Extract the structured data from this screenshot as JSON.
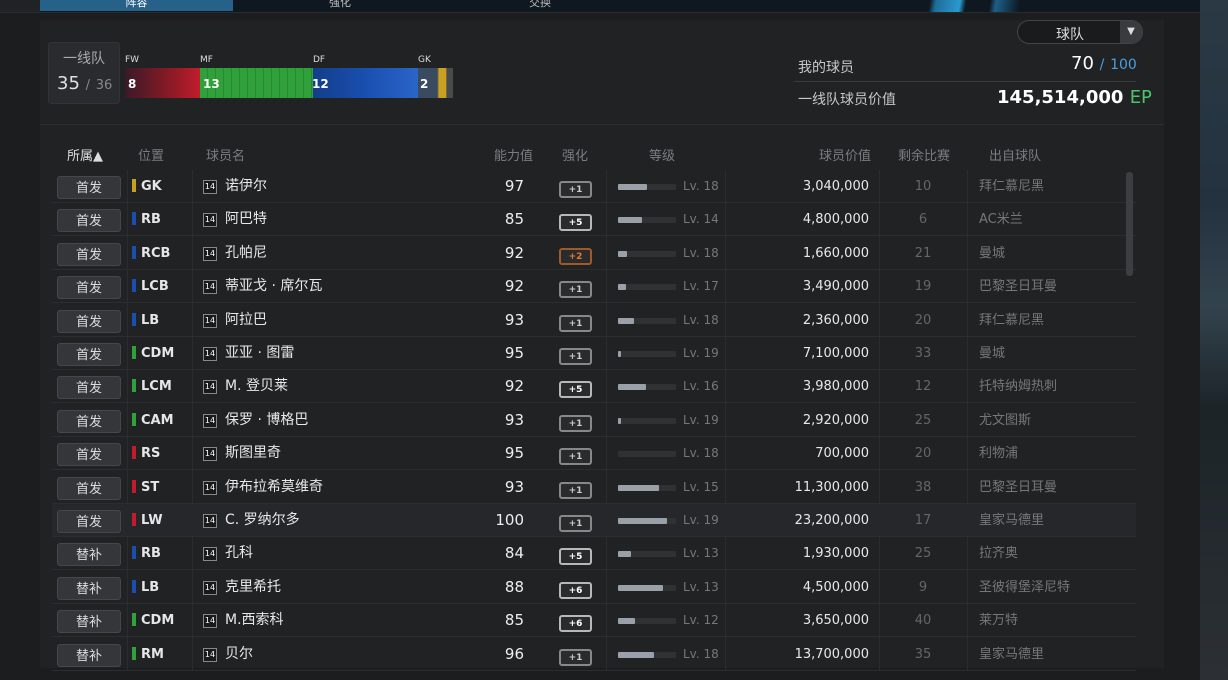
{
  "colors": {
    "fw": "#c01c2c",
    "mf": "#2fa03a",
    "df": "#1a4fb0",
    "gk": "#c9a020",
    "accent": "#4a9ee0",
    "ep": "#4cc46a"
  },
  "top_tabs": [
    "阵容",
    "强化",
    "交换"
  ],
  "summary": {
    "label": "一线队",
    "count": "35",
    "sep": "/",
    "max": "36"
  },
  "pos_labels": {
    "fw": "FW",
    "mf": "MF",
    "df": "DF",
    "gk": "GK"
  },
  "pos_counts": {
    "fw": "8",
    "mf": "13",
    "df": "12",
    "gk": "2"
  },
  "dropdown": {
    "value": "球队",
    "arrow": "▼"
  },
  "my_players": {
    "label": "我的球员",
    "value": "70",
    "sep": "/",
    "max": "100"
  },
  "first_team_value": {
    "label": "一线队球员价值",
    "value": "145,514,000",
    "unit": "EP"
  },
  "headers": {
    "category": "所属▲",
    "position": "位置",
    "name": "球员名",
    "ovr": "能力值",
    "enh": "强化",
    "level": "等级",
    "value": "球员价值",
    "games": "剩余比赛",
    "club": "出自球队"
  },
  "season_badge": "14",
  "rows": [
    {
      "cat": "首发",
      "pos": "GK",
      "pc": "gk",
      "name": "诺伊尔",
      "ovr": "97",
      "enh": "+1",
      "et": "n",
      "lvl": "Lv. 18",
      "lp": 0.5,
      "val": "3,040,000",
      "rem": "10",
      "club": "拜仁慕尼黑"
    },
    {
      "cat": "首发",
      "pos": "RB",
      "pc": "df",
      "name": "阿巴特",
      "ovr": "85",
      "enh": "+5",
      "et": "hi",
      "lvl": "Lv. 14",
      "lp": 0.42,
      "val": "4,800,000",
      "rem": "6",
      "club": "AC米兰"
    },
    {
      "cat": "首发",
      "pos": "RCB",
      "pc": "df",
      "name": "孔帕尼",
      "ovr": "92",
      "enh": "+2",
      "et": "red",
      "lvl": "Lv. 18",
      "lp": 0.16,
      "val": "1,660,000",
      "rem": "21",
      "club": "曼城"
    },
    {
      "cat": "首发",
      "pos": "LCB",
      "pc": "df",
      "name": "蒂亚戈 · 席尔瓦",
      "ovr": "92",
      "enh": "+1",
      "et": "n",
      "lvl": "Lv. 17",
      "lp": 0.14,
      "val": "3,490,000",
      "rem": "19",
      "club": "巴黎圣日耳曼"
    },
    {
      "cat": "首发",
      "pos": "LB",
      "pc": "df",
      "name": "阿拉巴",
      "ovr": "93",
      "enh": "+1",
      "et": "n",
      "lvl": "Lv. 18",
      "lp": 0.28,
      "val": "2,360,000",
      "rem": "20",
      "club": "拜仁慕尼黑"
    },
    {
      "cat": "首发",
      "pos": "CDM",
      "pc": "mf",
      "name": "亚亚 · 图雷",
      "ovr": "95",
      "enh": "+1",
      "et": "n",
      "lvl": "Lv. 19",
      "lp": 0.05,
      "val": "7,100,000",
      "rem": "33",
      "club": "曼城"
    },
    {
      "cat": "首发",
      "pos": "LCM",
      "pc": "mf",
      "name": "M. 登贝莱",
      "ovr": "92",
      "enh": "+5",
      "et": "hi",
      "lvl": "Lv. 16",
      "lp": 0.48,
      "val": "3,980,000",
      "rem": "12",
      "club": "托特纳姆热刺"
    },
    {
      "cat": "首发",
      "pos": "CAM",
      "pc": "mf",
      "name": "保罗 · 博格巴",
      "ovr": "93",
      "enh": "+1",
      "et": "n",
      "lvl": "Lv. 19",
      "lp": 0.06,
      "val": "2,920,000",
      "rem": "25",
      "club": "尤文图斯"
    },
    {
      "cat": "首发",
      "pos": "RS",
      "pc": "fw",
      "name": "斯图里奇",
      "ovr": "95",
      "enh": "+1",
      "et": "n",
      "lvl": "Lv. 18",
      "lp": 0,
      "val": "700,000",
      "rem": "20",
      "club": "利物浦"
    },
    {
      "cat": "首发",
      "pos": "ST",
      "pc": "fw",
      "name": "伊布拉希莫维奇",
      "ovr": "93",
      "enh": "+1",
      "et": "n",
      "lvl": "Lv. 15",
      "lp": 0.7,
      "val": "11,300,000",
      "rem": "38",
      "club": "巴黎圣日耳曼"
    },
    {
      "cat": "首发",
      "pos": "LW",
      "pc": "fw",
      "name": "C. 罗纳尔多",
      "ovr": "100",
      "enh": "+1",
      "et": "n",
      "lvl": "Lv. 19",
      "lp": 0.85,
      "val": "23,200,000",
      "rem": "17",
      "club": "皇家马德里",
      "hl": true
    },
    {
      "cat": "替补",
      "pos": "RB",
      "pc": "df",
      "name": "孔科",
      "ovr": "84",
      "enh": "+5",
      "et": "hi",
      "lvl": "Lv. 13",
      "lp": 0.22,
      "val": "1,930,000",
      "rem": "25",
      "club": "拉齐奥"
    },
    {
      "cat": "替补",
      "pos": "LB",
      "pc": "df",
      "name": "克里希托",
      "ovr": "88",
      "enh": "+6",
      "et": "hi",
      "lvl": "Lv. 13",
      "lp": 0.78,
      "val": "4,500,000",
      "rem": "9",
      "club": "圣彼得堡泽尼特"
    },
    {
      "cat": "替补",
      "pos": "CDM",
      "pc": "mf",
      "name": "M.西索科",
      "ovr": "85",
      "enh": "+6",
      "et": "hi",
      "lvl": "Lv. 12",
      "lp": 0.3,
      "val": "3,650,000",
      "rem": "40",
      "club": "莱万特"
    },
    {
      "cat": "替补",
      "pos": "RM",
      "pc": "mf",
      "name": "贝尔",
      "ovr": "96",
      "enh": "+1",
      "et": "n",
      "lvl": "Lv. 18",
      "lp": 0.62,
      "val": "13,700,000",
      "rem": "35",
      "club": "皇家马德里"
    }
  ]
}
